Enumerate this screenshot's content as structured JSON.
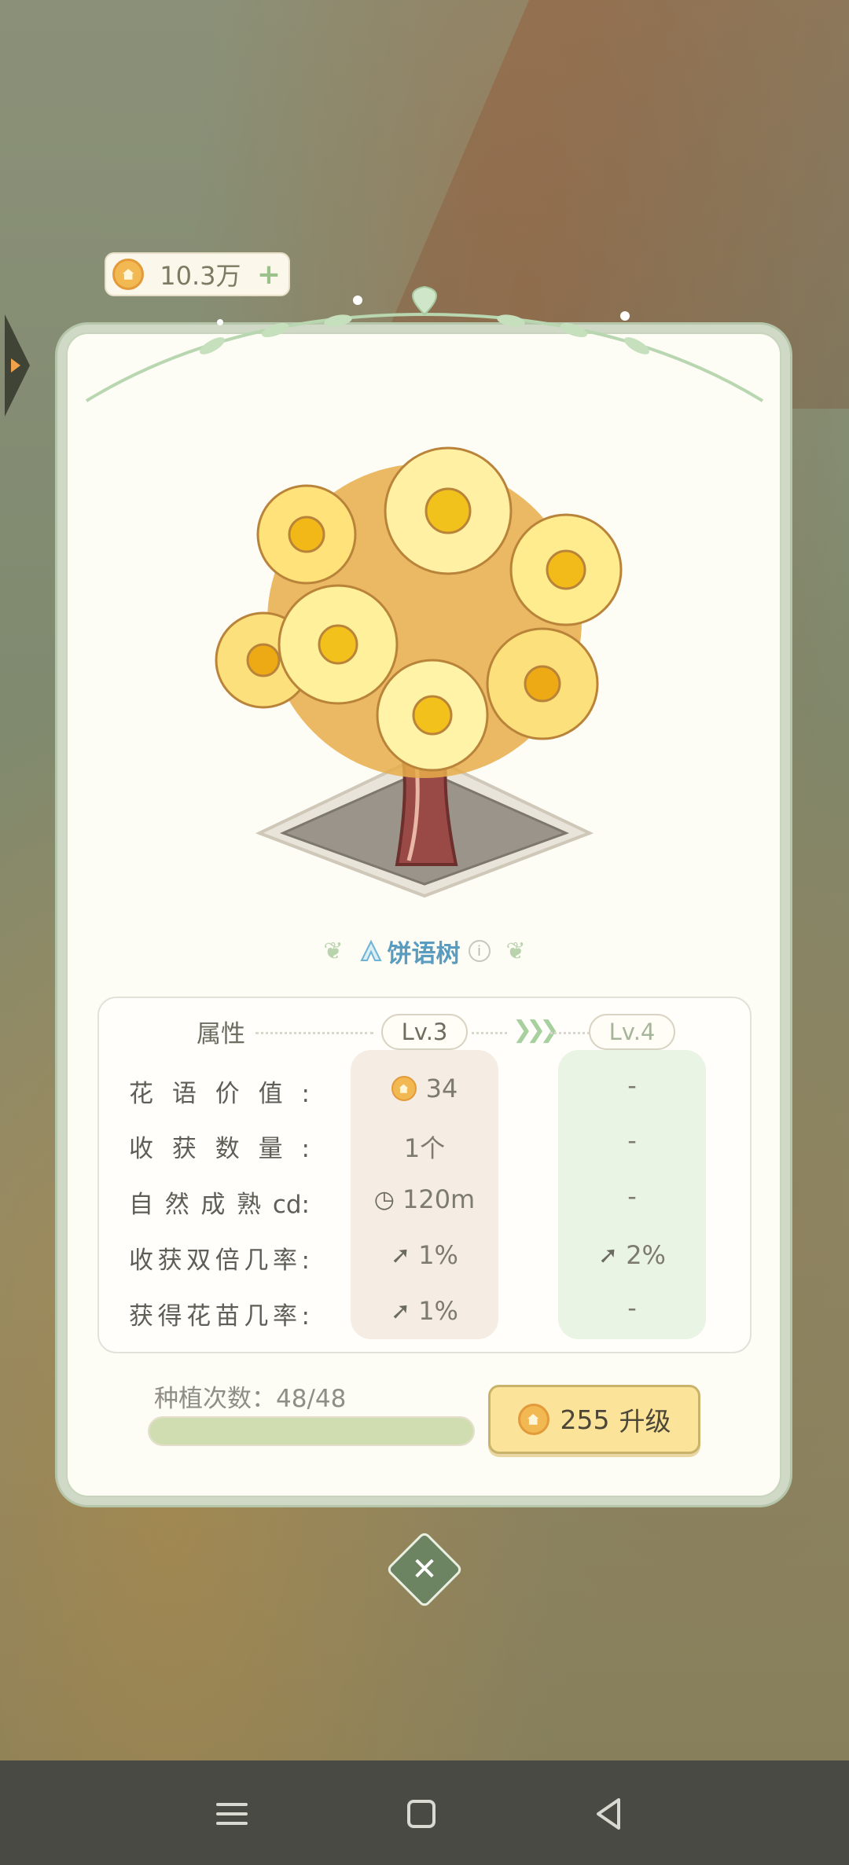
{
  "currency": {
    "amount": "10.3万",
    "plus": "+"
  },
  "item": {
    "name": "饼语树",
    "info": "i"
  },
  "stats": {
    "header": "属性",
    "current_level": "Lv.3",
    "next_level": "Lv.4",
    "rows": [
      {
        "label": "花语价值:",
        "current": "34",
        "next": "-",
        "current_icon": "coin-icon"
      },
      {
        "label": "收获数量:",
        "current": "1个",
        "next": "-"
      },
      {
        "label": "自然成熟cd:",
        "current": "120m",
        "next": "-",
        "current_icon": "clock-icon"
      },
      {
        "label": "收获双倍几率:",
        "current": "1%",
        "next": "2%",
        "current_icon": "arrow-up-icon",
        "next_icon": "arrow-up-icon"
      },
      {
        "label": "获得花苗几率:",
        "current": "1%",
        "next": "-",
        "current_icon": "arrow-up-icon"
      }
    ]
  },
  "planting": {
    "label": "种植次数：48/48",
    "progress": 1.0
  },
  "upgrade": {
    "cost": "255",
    "label": "升级"
  },
  "colors": {
    "accent_green": "#6d8463",
    "button_yellow": "#fbe39a",
    "title_blue": "#5a9cbf"
  }
}
